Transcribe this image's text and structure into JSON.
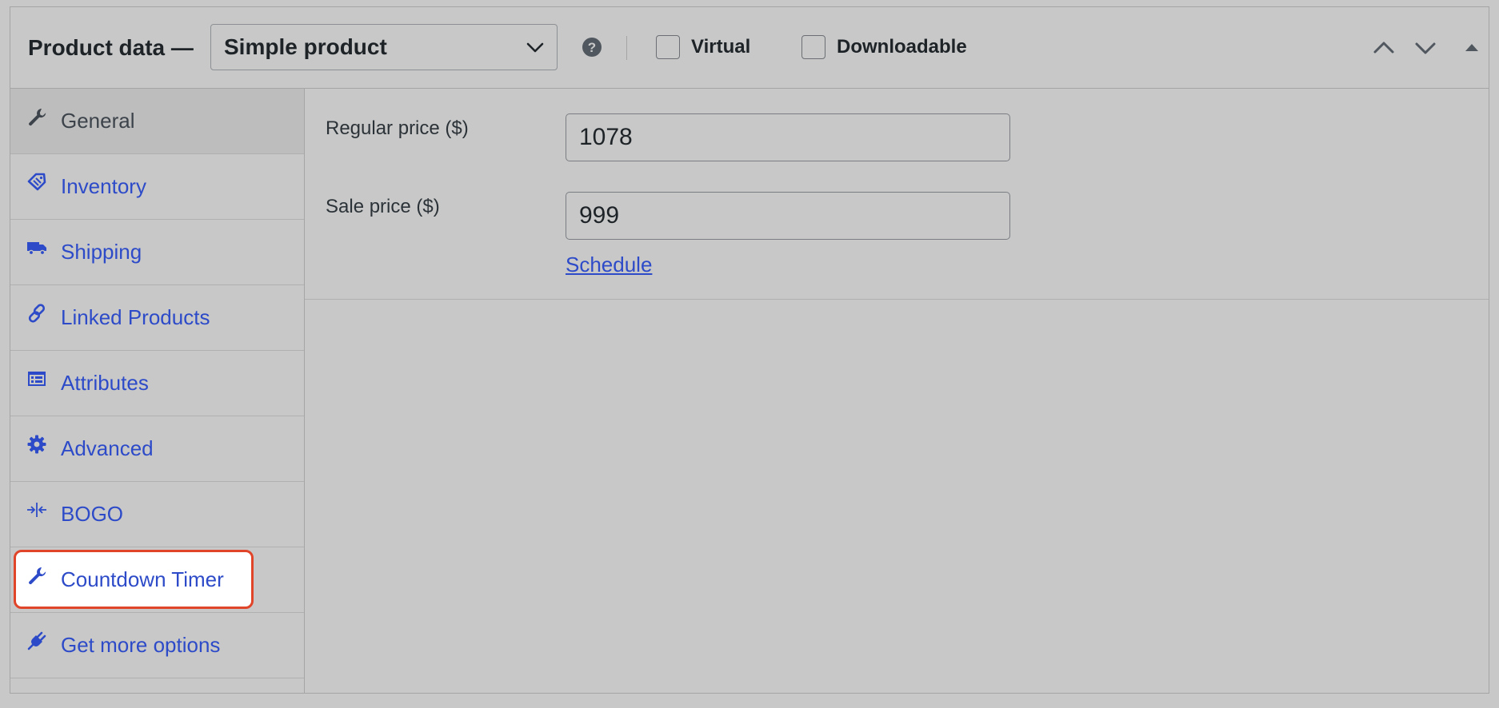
{
  "header": {
    "title": "Product data —",
    "product_type": "Simple product",
    "help_icon": "help-circle-icon",
    "virtual_label": "Virtual",
    "downloadable_label": "Downloadable",
    "virtual_checked": false,
    "downloadable_checked": false,
    "controls": [
      "move-up-icon",
      "move-down-icon",
      "collapse-toggle-icon"
    ]
  },
  "sidebar": {
    "items": [
      {
        "label": "General",
        "icon": "wrench-icon",
        "active": true
      },
      {
        "label": "Inventory",
        "icon": "tag-icon",
        "active": false
      },
      {
        "label": "Shipping",
        "icon": "truck-icon",
        "active": false
      },
      {
        "label": "Linked Products",
        "icon": "link-icon",
        "active": false
      },
      {
        "label": "Attributes",
        "icon": "list-table-icon",
        "active": false
      },
      {
        "label": "Advanced",
        "icon": "gear-icon",
        "active": false
      },
      {
        "label": "BOGO",
        "icon": "arrows-in-icon",
        "active": false
      },
      {
        "label": "Countdown Timer",
        "icon": "wrench-icon",
        "active": false,
        "highlighted": true
      },
      {
        "label": "Get more options",
        "icon": "plugin-icon",
        "active": false
      }
    ]
  },
  "general": {
    "regular_price_label": "Regular price ($)",
    "regular_price_value": "1078",
    "sale_price_label": "Sale price ($)",
    "sale_price_value": "999",
    "schedule_label": "Schedule"
  },
  "colors": {
    "background": "#c8c8c8",
    "link": "#2d4bc8",
    "highlight_border": "#e0452a",
    "text": "#1d2327"
  }
}
